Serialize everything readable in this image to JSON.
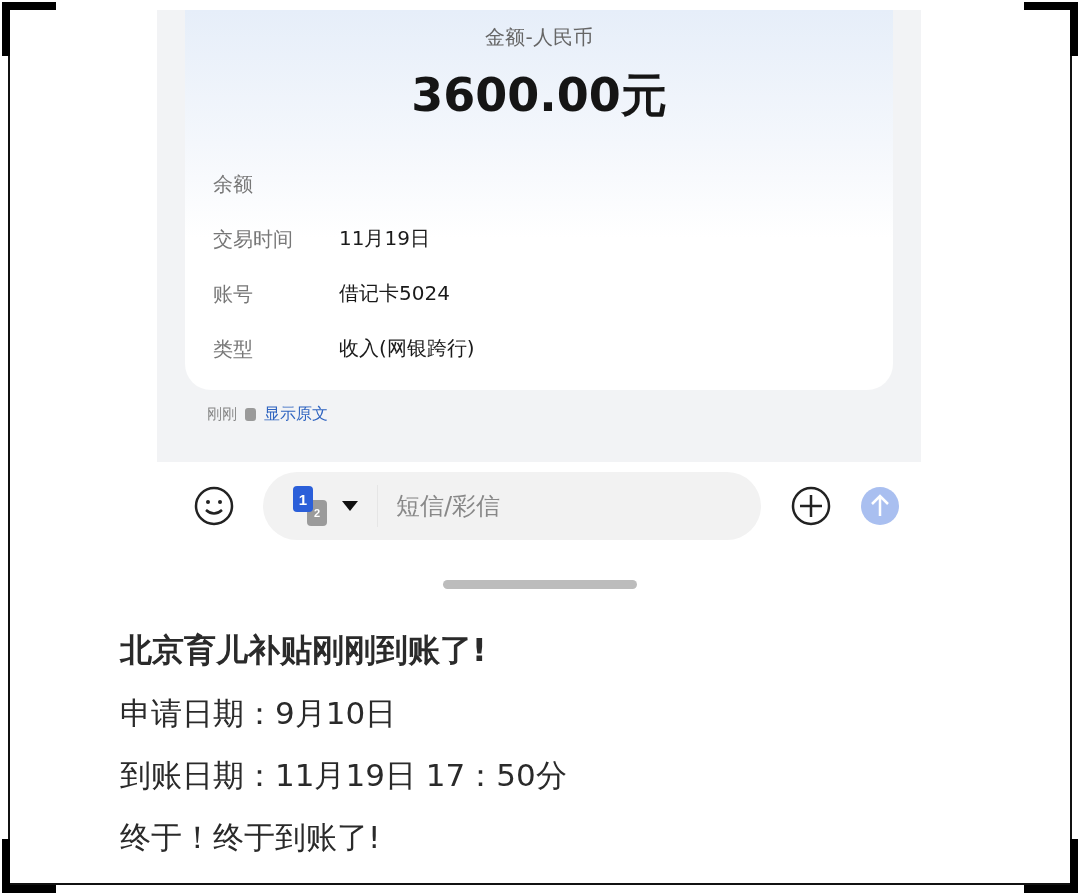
{
  "message_card": {
    "amount_label": "金额-人民币",
    "amount": "3600.00元",
    "fields": [
      {
        "label": "余额"
      },
      {
        "label": "交易时间",
        "value": "11月19日"
      },
      {
        "label": "账号",
        "value": "借记卡5024"
      },
      {
        "label": "类型",
        "value": "收入(网银跨行)"
      }
    ]
  },
  "message_meta": {
    "time": "刚刚",
    "show_original": "显示原文"
  },
  "composer": {
    "sim_primary": "1",
    "sim_secondary": "2",
    "placeholder": "短信/彩信"
  },
  "post": {
    "title": "北京育儿补贴刚刚到账了!",
    "lines": [
      "申请日期：9月10日",
      "到账日期：11月19日 17：50分",
      "终于！终于到账了!"
    ]
  }
}
